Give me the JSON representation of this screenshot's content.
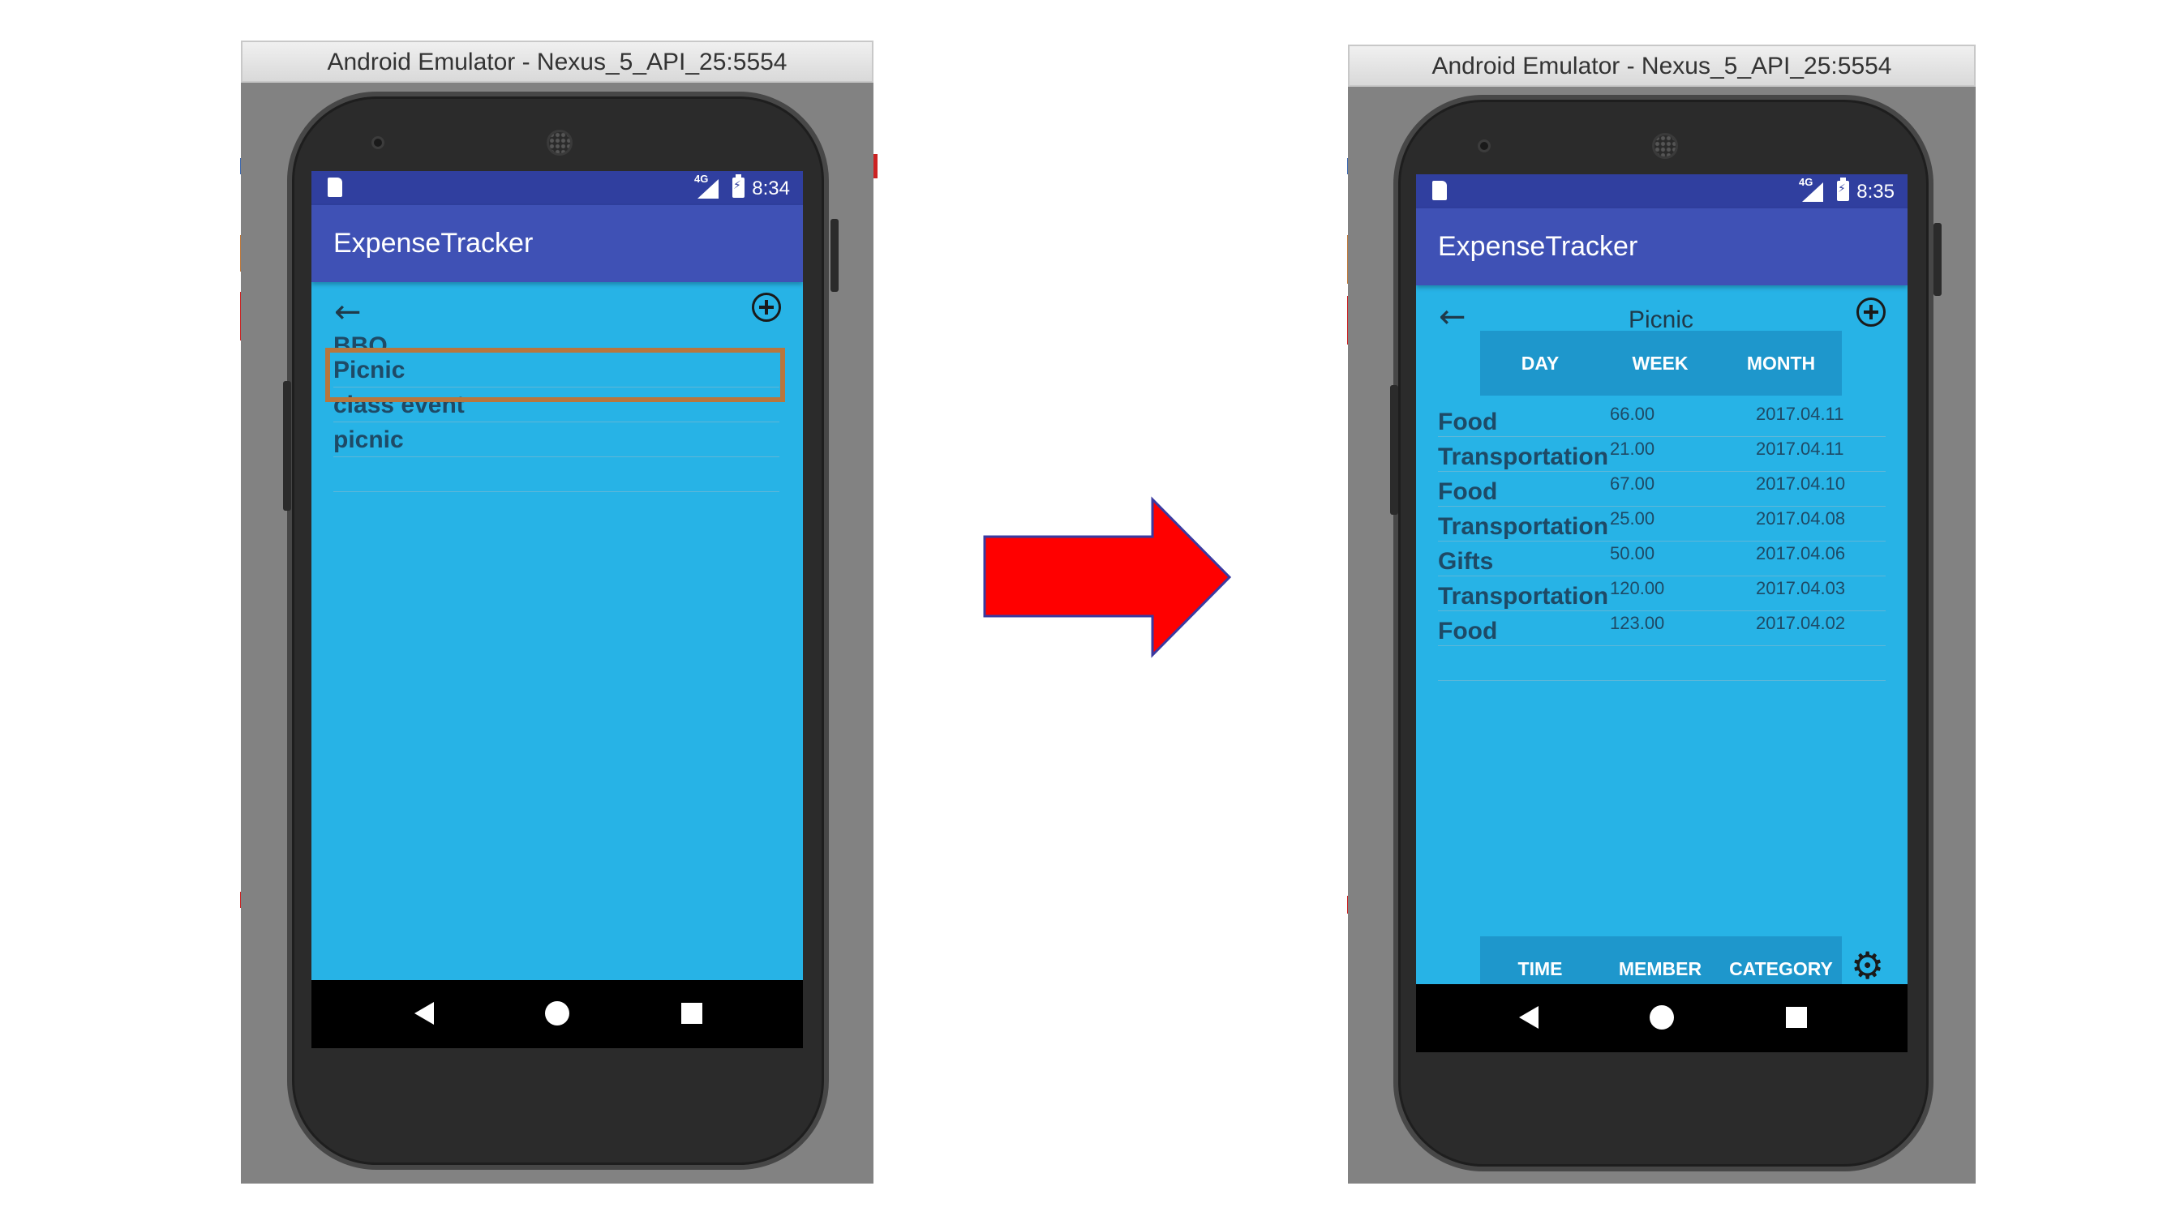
{
  "left_emulator": {
    "window_title": "Android Emulator - Nexus_5_API_25:5554",
    "status_time": "8:34",
    "signal_label": "4G",
    "app_title": "ExpenseTracker",
    "events": [
      {
        "label": "BBQ"
      },
      {
        "label": "Picnic",
        "highlighted": true
      },
      {
        "label": "class event"
      },
      {
        "label": "picnic"
      }
    ],
    "highlight_color": "#b8763d"
  },
  "right_emulator": {
    "window_title": "Android Emulator - Nexus_5_API_25:5554",
    "status_time": "8:35",
    "signal_label": "4G",
    "app_title": "ExpenseTracker",
    "screen_title": "Picnic",
    "top_tabs": [
      "DAY",
      "WEEK",
      "MONTH"
    ],
    "expenses": [
      {
        "category": "Food",
        "amount": "66.00",
        "date": "2017.04.11"
      },
      {
        "category": "Transportation",
        "amount": "21.00",
        "date": "2017.04.11"
      },
      {
        "category": "Food",
        "amount": "67.00",
        "date": "2017.04.10"
      },
      {
        "category": "Transportation",
        "amount": "25.00",
        "date": "2017.04.08"
      },
      {
        "category": "Gifts",
        "amount": "50.00",
        "date": "2017.04.06"
      },
      {
        "category": "Transportation",
        "amount": "120.00",
        "date": "2017.04.03"
      },
      {
        "category": "Food",
        "amount": "123.00",
        "date": "2017.04.02"
      }
    ],
    "bottom_tabs": [
      "TIME",
      "MEMBER",
      "CATEGORY"
    ]
  },
  "colors": {
    "status_bar": "#303f9f",
    "app_bar": "#3f51b5",
    "screen_background": "#27b3e6",
    "tab_bar": "#1e97cc",
    "arrow_fill": "#ff0000",
    "arrow_outline": "#3a3aa0"
  },
  "icons": {
    "back": "arrow-left-icon",
    "add": "add-circle-icon",
    "settings": "gear-icon",
    "nav_back": "triangle-back-icon",
    "nav_home": "circle-home-icon",
    "nav_recent": "square-recent-icon",
    "transition": "right-arrow-icon"
  }
}
